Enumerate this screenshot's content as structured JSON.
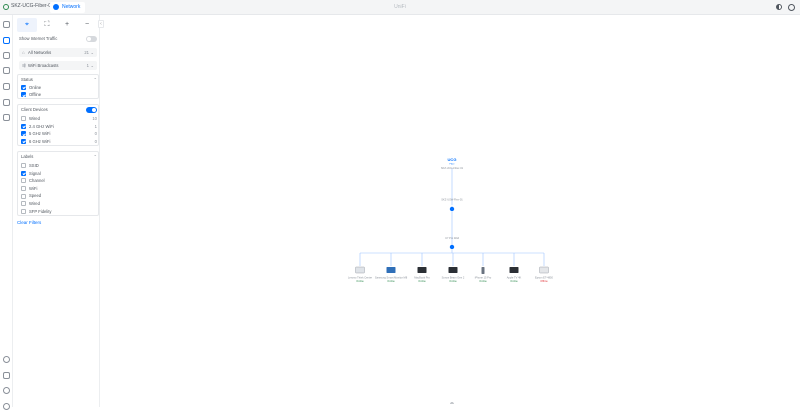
{
  "topbar": {
    "console_name": "SKZ-UCG-Fiber-01",
    "active_tab": "Network",
    "brand": "UniFi"
  },
  "toolbar": {
    "cursor_icon": "⌖",
    "fit_icon": "⛶",
    "zoom_in": "+",
    "zoom_out": "−",
    "collapse": "‹"
  },
  "filters": {
    "show_internet_label": "Show Internet Traffic",
    "networks": {
      "icon": "⌂",
      "label": "All Networks",
      "count": "21",
      "chevron": "⌄"
    },
    "wifi": {
      "icon": "⇶",
      "label": "WiFi Broadcasts",
      "count": "1",
      "chevron": "⌄"
    },
    "status": {
      "header": "Status",
      "chevron": "⌃",
      "items": [
        {
          "label": "Online",
          "checked": true
        },
        {
          "label": "Offline",
          "checked": true
        }
      ]
    },
    "client_devices": {
      "header": "Client Devices",
      "items": [
        {
          "label": "Wired",
          "count": "10",
          "checked": false
        },
        {
          "label": "2.4 GHz WiFi",
          "count": "1",
          "checked": true
        },
        {
          "label": "5 GHz WiFi",
          "count": "0",
          "checked": true
        },
        {
          "label": "6 GHz WiFi",
          "count": "0",
          "checked": true
        }
      ]
    },
    "labels": {
      "header": "Labels",
      "chevron": "⌃",
      "items": [
        {
          "label": "SSID",
          "checked": false
        },
        {
          "label": "Signal",
          "checked": true
        },
        {
          "label": "Channel",
          "checked": false
        },
        {
          "label": "WiFi",
          "checked": false
        },
        {
          "label": "Speed",
          "checked": false
        },
        {
          "label": "Wired",
          "checked": false
        },
        {
          "label": "SFP Fidelity",
          "checked": false
        }
      ]
    },
    "clear_label": "Clear Filters"
  },
  "topology": {
    "gateway": {
      "name": "UCG",
      "sub": "Fiber",
      "label": "SKZ-UCG-Fiber-01"
    },
    "switch": {
      "label": "SKZ-USW-Flex-01"
    },
    "ap": {
      "label": "U7 Pro Wall"
    },
    "clients": [
      {
        "label": "Lenovo Think Centre",
        "status": "Online",
        "color": "#2d8a4e"
      },
      {
        "label": "Samsung Smart Monitor M8",
        "status": "Online",
        "color": "#2d8a4e"
      },
      {
        "label": "MacBook Pro",
        "status": "Online",
        "color": "#2d8a4e"
      },
      {
        "label": "Sonos Beam Gen 2",
        "status": "Online",
        "color": "#2d8a4e"
      },
      {
        "label": "iPhone 15 Pro",
        "status": "Online",
        "color": "#2d8a4e"
      },
      {
        "label": "Apple TV 4K",
        "status": "Online",
        "color": "#2d8a4e"
      },
      {
        "label": "Epson ET-4850",
        "status": "Offline",
        "color": "#e0353b"
      }
    ]
  },
  "colors": {
    "accent": "#006fff",
    "online": "#2d8a4e",
    "offline": "#e0353b",
    "link": "#9cc3ff"
  }
}
